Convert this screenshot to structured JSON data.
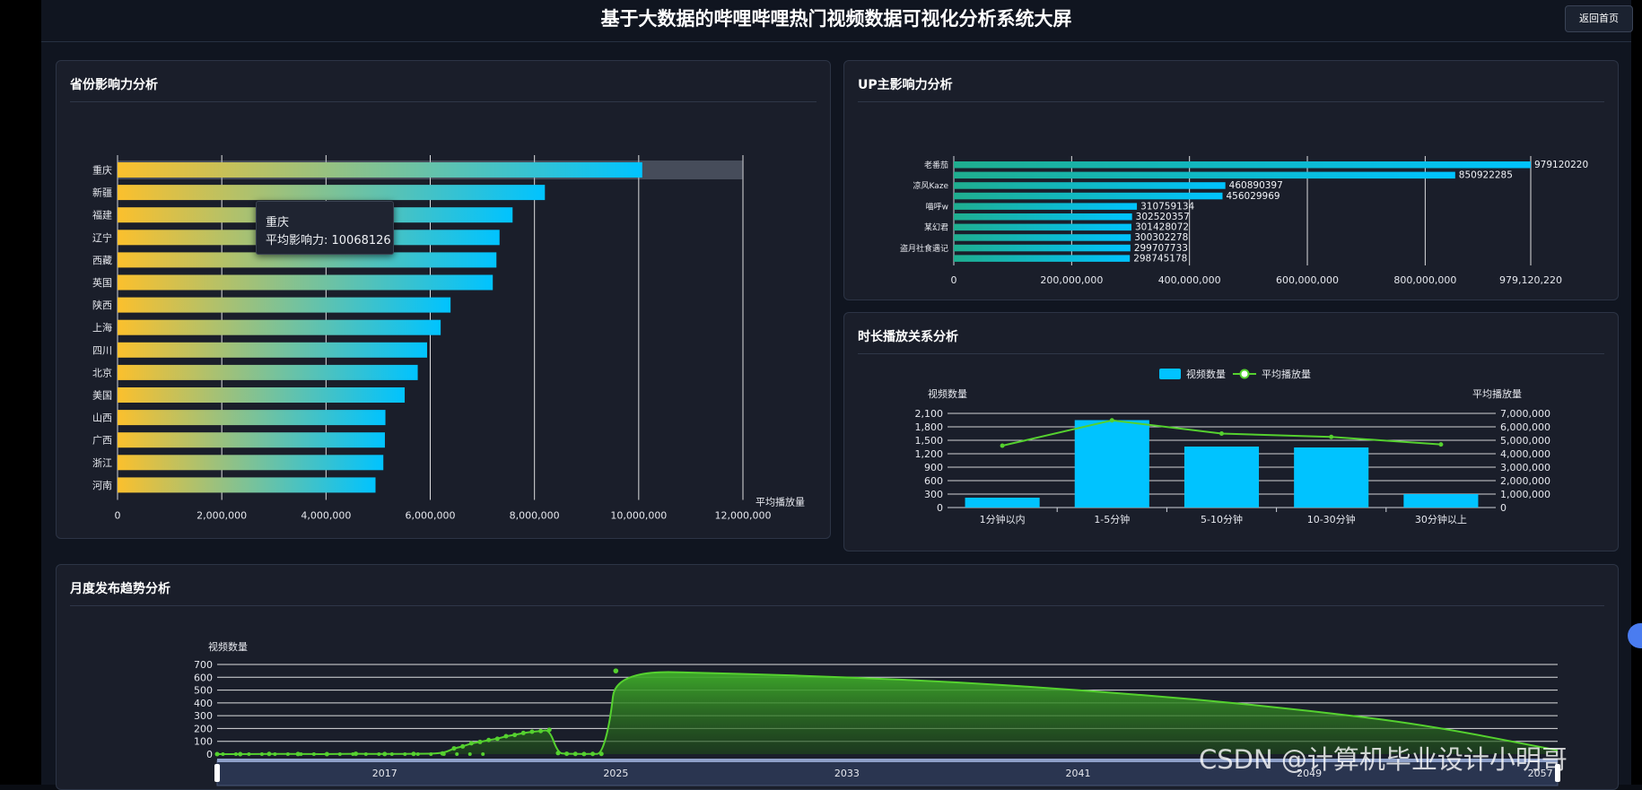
{
  "header": {
    "title": "基于大数据的哔哩哔哩热门视频数据可视化分析系统大屏",
    "back_label": "返回首页"
  },
  "panels": {
    "province": {
      "title": "省份影响力分析"
    },
    "up": {
      "title": "UP主影响力分析"
    },
    "duration": {
      "title": "时长播放关系分析"
    },
    "monthly": {
      "title": "月度发布趋势分析"
    }
  },
  "tooltip": {
    "name": "重庆",
    "line": "平均影响力: 10068126"
  },
  "watermark": "CSDN @计算机毕业设计小明哥",
  "colors": {
    "accent_cyan": "#00c3ff",
    "accent_yellow": "#fbc02d",
    "teal": "#1fae8f",
    "green": "#55d12f"
  },
  "chart_data": [
    {
      "id": "province",
      "type": "bar",
      "orientation": "horizontal",
      "categories": [
        "重庆",
        "新疆",
        "福建",
        "辽宁",
        "西藏",
        "英国",
        "陕西",
        "上海",
        "四川",
        "北京",
        "美国",
        "山西",
        "广西",
        "浙江",
        "河南"
      ],
      "values": [
        10068126,
        8200000,
        7580000,
        7330000,
        7270000,
        7200000,
        6390000,
        6200000,
        5940000,
        5760000,
        5510000,
        5140000,
        5130000,
        5100000,
        4950000
      ],
      "xlabel": "平均播放量",
      "xlim": [
        0,
        12000000
      ],
      "xticks": [
        "0",
        "2,000,000",
        "4,000,000",
        "6,000,000",
        "8,000,000",
        "10,000,000",
        "12,000,000"
      ],
      "highlighted": "重庆"
    },
    {
      "id": "up",
      "type": "bar",
      "orientation": "horizontal",
      "categories": [
        "老番茄",
        "",
        "凉风Kaze",
        "",
        "喵呼w",
        "",
        "某幻君",
        "",
        "盗月社食遇记",
        ""
      ],
      "values": [
        979120220,
        850922285,
        460890397,
        456029969,
        310759134,
        302520357,
        301428072,
        300302278,
        299707733,
        298745178
      ],
      "data_labels": [
        "979120220",
        "850922285",
        "460890397",
        "456029969",
        "310759134",
        "302520357",
        "301428072",
        "300302278",
        "299707733",
        "298745178"
      ],
      "xlim": [
        0,
        979120220
      ],
      "xticks": [
        "0",
        "200,000,000",
        "400,000,000",
        "600,000,000",
        "800,000,000",
        "979,120,220"
      ]
    },
    {
      "id": "duration",
      "type": "bar",
      "categories": [
        "1分钟以内",
        "1-5分钟",
        "5-10分钟",
        "10-30分钟",
        "30分钟以上"
      ],
      "series": [
        {
          "name": "视频数量",
          "type": "bar",
          "values": [
            220,
            1950,
            1360,
            1340,
            300
          ]
        },
        {
          "name": "平均播放量",
          "type": "line",
          "values": [
            4600000,
            6480000,
            5500000,
            5250000,
            4690000
          ]
        }
      ],
      "ylabel": "视频数量",
      "ylabel_right": "平均播放量",
      "ylim": [
        0,
        2100
      ],
      "ylim_right": [
        0,
        7000000
      ],
      "yticks": [
        "0",
        "300",
        "600",
        "900",
        "1,200",
        "1,500",
        "1,800",
        "2,100"
      ],
      "yticks_right": [
        "0",
        "1,000,000",
        "2,000,000",
        "3,000,000",
        "4,000,000",
        "5,000,000",
        "6,000,000",
        "7,000,000"
      ],
      "legend": "top-center"
    },
    {
      "id": "monthly",
      "type": "area",
      "ylabel": "视频数量",
      "ylim": [
        0,
        700
      ],
      "yticks": [
        "0",
        "100",
        "200",
        "300",
        "400",
        "500",
        "600",
        "700"
      ],
      "xlim": [
        2011.2,
        2057.6
      ],
      "slider_ticks": [
        "2017",
        "2025",
        "2033",
        "2041",
        "2049",
        "2057"
      ],
      "series": [
        {
          "x": [
            2011.2,
            2012,
            2013,
            2014,
            2015,
            2016,
            2017,
            2018,
            2019,
            2019.4,
            2019.7,
            2020,
            2020.3,
            2020.6,
            2020.9,
            2021.2,
            2021.5,
            2021.8,
            2022.1,
            2022.4,
            2022.7,
            2023,
            2023.3,
            2023.6,
            2023.9,
            2024.2,
            2024.5,
            2024.8,
            2025,
            2029,
            2033,
            2037,
            2041,
            2045,
            2049,
            2053,
            2057.6
          ],
          "y": [
            0,
            0,
            2,
            1,
            0,
            3,
            1,
            2,
            5,
            45,
            60,
            85,
            95,
            110,
            120,
            140,
            150,
            165,
            175,
            180,
            190,
            8,
            3,
            2,
            1,
            2,
            2,
            250,
            650,
            630,
            600,
            560,
            500,
            430,
            340,
            230,
            30
          ]
        }
      ]
    }
  ]
}
